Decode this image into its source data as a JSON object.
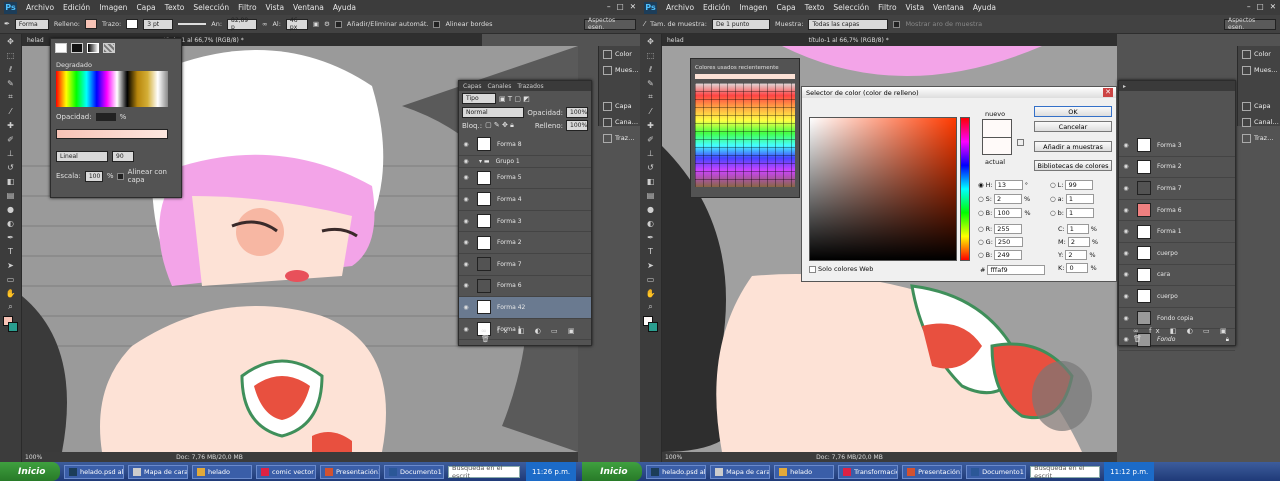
{
  "left": {
    "menu": [
      "Archivo",
      "Edición",
      "Imagen",
      "Capa",
      "Texto",
      "Selección",
      "Filtro",
      "Vista",
      "Ventana",
      "Ayuda"
    ],
    "options": {
      "shape": "Forma",
      "fill_label": "Relleno:",
      "stroke_label": "Trazo:",
      "stroke_size": "3 pt",
      "w_label": "An:",
      "w_value": "82,89 p",
      "h_label": "Al:",
      "h_value": "46 px",
      "auto_add": "Añadir/Eliminar automát.",
      "align": "Alinear bordes",
      "workspace": "Aspectos esen."
    },
    "doc_tab": "helad",
    "doc_tab2": "título-1 al 66,7% (RGB/8) *",
    "zoom": "100%",
    "doc": "Doc: 7,76 MB/20,0 MB",
    "gradient": {
      "title": "Degradado",
      "opacity": "Opacidad:",
      "opacity_unit": "%",
      "type": "Lineal",
      "angle": "90",
      "scale": "Escala:",
      "scale_value": "100",
      "scale_unit": "%",
      "align": "Alinear con capa"
    },
    "layers_panel": {
      "tabs": [
        "Capas",
        "Canales",
        "Trazados"
      ],
      "kind": "Tipo",
      "blend": "Normal",
      "opacity_label": "Opacidad:",
      "opacity": "100%",
      "lock": "Bloq.:",
      "fill_label": "Relleno:",
      "fill": "100%",
      "layers": [
        "Forma 8",
        "Grupo 1",
        "Forma 5",
        "Forma 4",
        "Forma 3",
        "Forma 2",
        "Forma 7",
        "Forma 6",
        "Forma 42",
        "Forma 1"
      ]
    },
    "dock": [
      "Color",
      "Mues…",
      "Capa",
      "Cana…",
      "Traz…"
    ]
  },
  "right": {
    "menu": [
      "Archivo",
      "Edición",
      "Imagen",
      "Capa",
      "Texto",
      "Selección",
      "Filtro",
      "Vista",
      "Ventana",
      "Ayuda"
    ],
    "options": {
      "sample_label": "Tam. de muestra:",
      "sample": "De 1 punto",
      "sample2_label": "Muestra:",
      "sample2": "Todas las capas",
      "ring": "Mostrar aro de muestra",
      "workspace": "Aspectos esen."
    },
    "doc_tab": "helad",
    "doc_tab2": "título-1 al 66,7% (RGB/8) *",
    "zoom": "100%",
    "doc": "Doc: 7,76 MB/20,0 MB",
    "swatches_title": "Colores usados recientemente",
    "picker": {
      "title": "Selector de color (color de relleno)",
      "new": "nuevo",
      "current": "actual",
      "ok": "OK",
      "cancel": "Cancelar",
      "add": "Añadir a muestras",
      "libs": "Bibliotecas de colores",
      "H": "13",
      "H_u": "°",
      "S": "2",
      "S_u": "%",
      "B": "100",
      "B_u": "%",
      "R": "255",
      "G": "250",
      "B2": "249",
      "L": "99",
      "a": "1",
      "b": "1",
      "C": "1",
      "M": "2",
      "Y": "2",
      "K": "0",
      "hex": "fffaf9",
      "web": "Solo colores Web"
    },
    "layers": [
      "Forma 3",
      "Forma 2",
      "Forma 7",
      "Forma 6",
      "Forma 1",
      "cuerpo",
      "cara",
      "cuerpo",
      "Fondo copia",
      "Fondo"
    ],
    "dock": [
      "Color",
      "Mues…",
      "Capa",
      "Canal…",
      "Traz…"
    ]
  },
  "taskbar": {
    "start": "Inicio",
    "left_items": [
      "helado.psd al 1…",
      "Mapa de carac…",
      "helado",
      "comic vector gi…",
      "Presentación1 …",
      "Documento1 -…"
    ],
    "left_search": "Búsqueda en el escrit",
    "left_clock": "11:26 p.m.",
    "right_items": [
      "helado.psd al 1…",
      "Mapa de carac…",
      "helado",
      "Transformació…",
      "Presentación1 …",
      "Documento1 -…"
    ],
    "right_search": "Búsqueda en el escrit",
    "right_clock": "11:12 p.m."
  },
  "colors": {
    "skin": "#fde2d6",
    "hair_pink": "#f3a4e8",
    "hair_white": "#ffffff",
    "watermelon": "#e8503f",
    "rind": "#3f8f5a",
    "fg_swatch": "#f7c3b6"
  }
}
